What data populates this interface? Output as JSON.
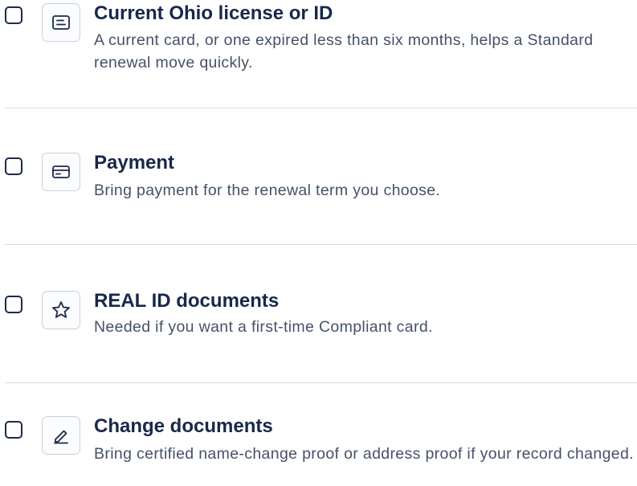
{
  "checklist": {
    "items": [
      {
        "title": "Current Ohio license or ID",
        "description": "A current card, or one expired less than six months, helps a Standard renewal move quickly.",
        "icon": "id-card-icon",
        "checked": false
      },
      {
        "title": "Payment",
        "description": "Bring payment for the renewal term you choose.",
        "icon": "credit-card-icon",
        "checked": false
      },
      {
        "title": "REAL ID documents",
        "description": "Needed if you want a first-time Compliant card.",
        "icon": "star-icon",
        "checked": false
      },
      {
        "title": "Change documents",
        "description": "Bring certified name-change proof or address proof if your record changed.",
        "icon": "pencil-icon",
        "checked": false
      }
    ]
  },
  "colors": {
    "text_primary": "#17284a",
    "text_secondary": "#445169",
    "border": "#c8d0db",
    "divider": "#d6dbe3"
  }
}
